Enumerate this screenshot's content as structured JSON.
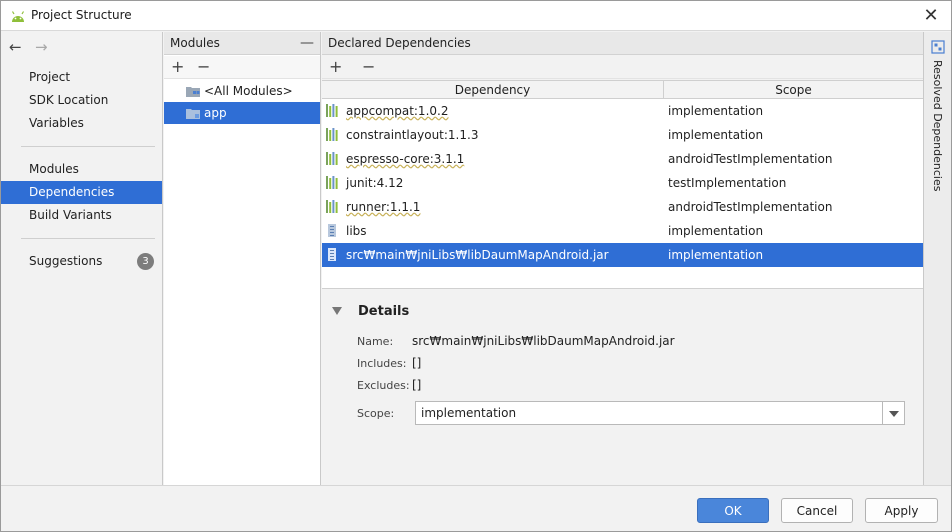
{
  "window": {
    "title": "Project Structure",
    "app_icon": "android-icon",
    "close_icon": "close-icon"
  },
  "nav": {
    "back_icon": "arrow-left-icon",
    "forward_icon": "arrow-right-icon",
    "items": [
      {
        "label": "Project"
      },
      {
        "label": "SDK Location"
      },
      {
        "label": "Variables"
      },
      {
        "label": "Modules"
      },
      {
        "label": "Dependencies",
        "selected": true
      },
      {
        "label": "Build Variants"
      },
      {
        "label": "Suggestions",
        "badge": "3"
      }
    ]
  },
  "modules": {
    "header": "Modules",
    "add_icon": "plus-icon",
    "remove_icon": "minus-icon",
    "items": [
      {
        "label": "<All Modules>"
      },
      {
        "label": "app",
        "selected": true
      }
    ]
  },
  "declared": {
    "header": "Declared Dependencies",
    "columns": {
      "dependency": "Dependency",
      "scope": "Scope"
    },
    "rows": [
      {
        "name": "appcompat:1.0.2",
        "scope": "implementation",
        "icon": "library-icon",
        "wavy": true
      },
      {
        "name": "constraintlayout:1.1.3",
        "scope": "implementation",
        "icon": "library-icon",
        "wavy": false
      },
      {
        "name": "espresso-core:3.1.1",
        "scope": "androidTestImplementation",
        "icon": "library-icon",
        "wavy": true
      },
      {
        "name": "junit:4.12",
        "scope": "testImplementation",
        "icon": "library-icon",
        "wavy": false
      },
      {
        "name": "runner:1.1.1",
        "scope": "androidTestImplementation",
        "icon": "library-icon",
        "wavy": true
      },
      {
        "name": "libs",
        "scope": "implementation",
        "icon": "jar-icon",
        "wavy": false
      },
      {
        "name": "src₩main₩jniLibs₩libDaumMapAndroid.jar",
        "scope": "implementation",
        "icon": "jar-icon",
        "wavy": false,
        "selected": true
      }
    ]
  },
  "details": {
    "title": "Details",
    "name_label": "Name:",
    "name_value": "src₩main₩jniLibs₩libDaumMapAndroid.jar",
    "includes_label": "Includes:",
    "includes_value": "[]",
    "excludes_label": "Excludes:",
    "excludes_value": "[]",
    "scope_label": "Scope:",
    "scope_value": "implementation"
  },
  "sidebar_right": {
    "label": "Resolved Dependencies",
    "icon": "resolved-dependencies-icon"
  },
  "buttons": {
    "ok": "OK",
    "cancel": "Cancel",
    "apply": "Apply"
  },
  "colors": {
    "selection": "#2f6ed5",
    "primary_button": "#4a86da",
    "android_green": "#8fbf3a"
  }
}
